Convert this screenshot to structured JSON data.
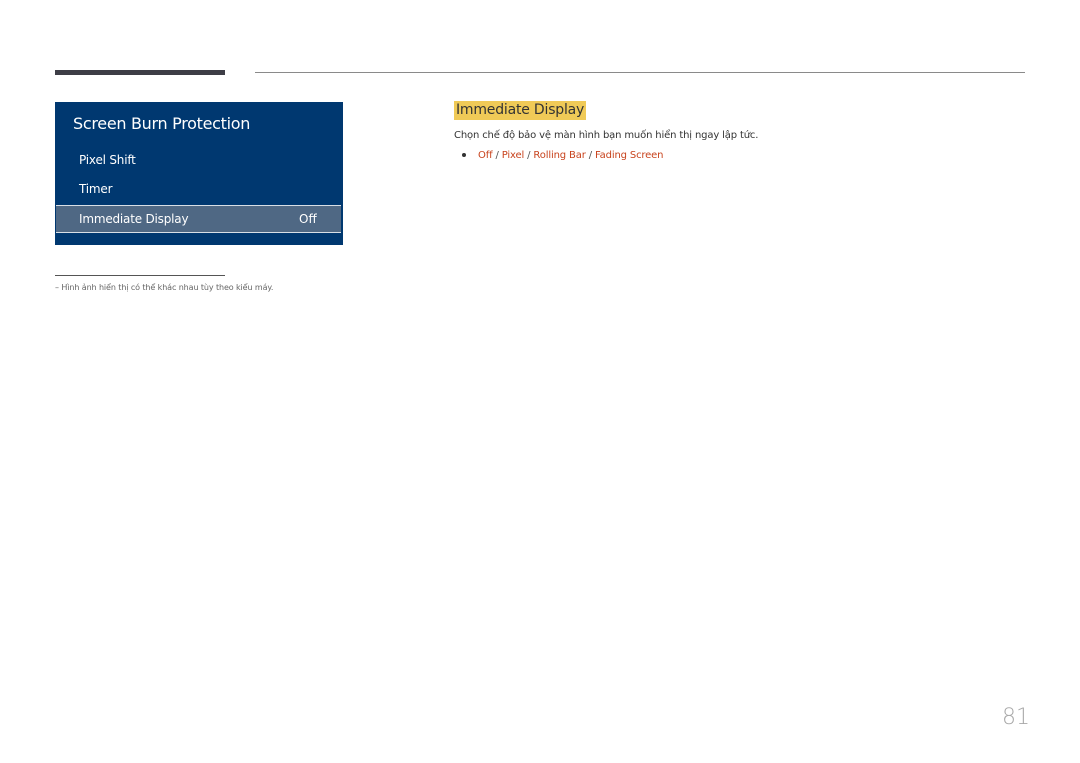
{
  "osd": {
    "title": "Screen Burn Protection",
    "items": [
      {
        "label": "Pixel Shift"
      },
      {
        "label": "Timer"
      },
      {
        "label": "Immediate Display",
        "value": "Off",
        "selected": true
      }
    ]
  },
  "section": {
    "heading": "Immediate Display",
    "description": "Chọn chế độ bảo vệ màn hình bạn muốn hiển thị ngay lập tức.",
    "options": [
      "Off",
      "Pixel",
      "Rolling Bar",
      "Fading Screen"
    ],
    "separator": " / "
  },
  "footnote": "–  Hình ảnh hiển thị có thể khác nhau tùy theo kiểu máy.",
  "page_number": "81",
  "colors": {
    "osd_background": "#003870",
    "osd_selected": "#4f6884",
    "heading_highlight": "#f0ca57",
    "option_text": "#c8431d"
  }
}
